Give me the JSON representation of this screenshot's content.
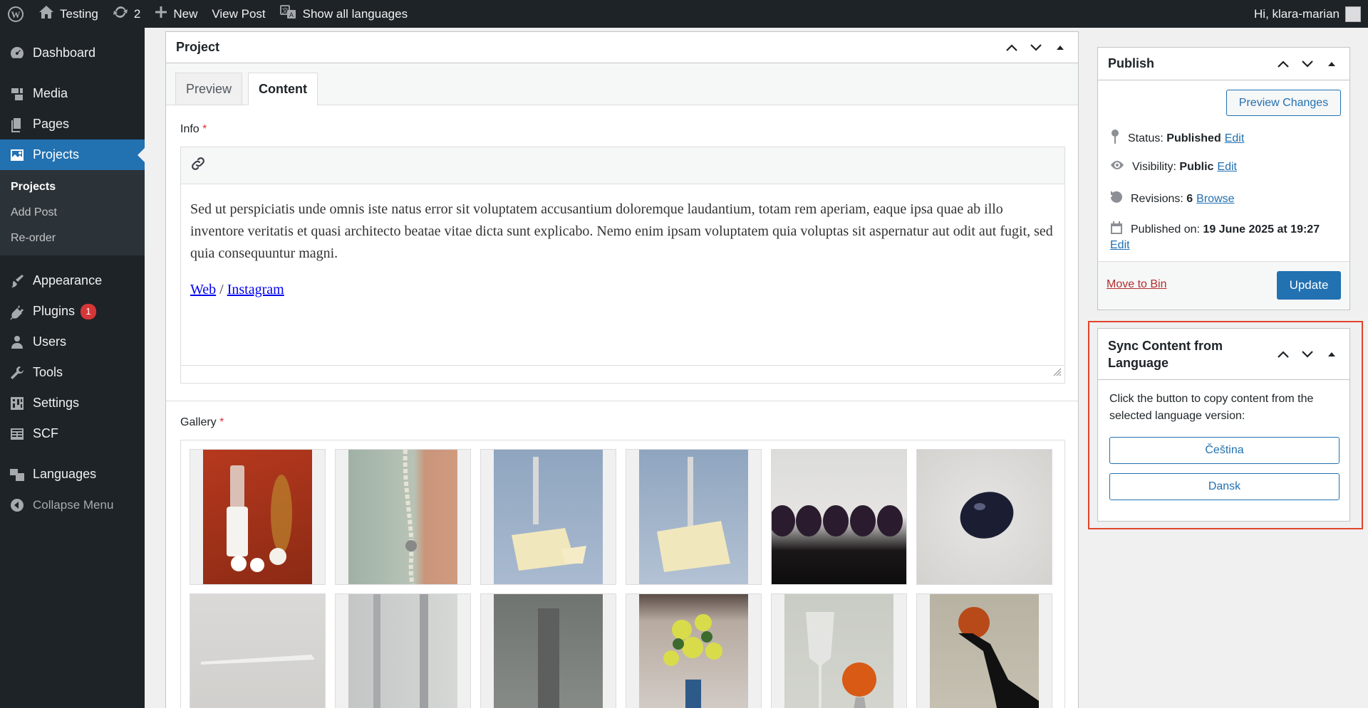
{
  "admin_bar": {
    "site_name": "Testing",
    "updates_count": "2",
    "new_label": "New",
    "view_post": "View Post",
    "show_languages": "Show all languages",
    "greeting": "Hi, klara-marian"
  },
  "sidebar": {
    "items": [
      {
        "label": "Dashboard",
        "icon": "dashboard-icon"
      },
      {
        "label": "Media",
        "icon": "media-icon"
      },
      {
        "label": "Pages",
        "icon": "pages-icon"
      },
      {
        "label": "Projects",
        "icon": "projects-icon"
      },
      {
        "label": "Appearance",
        "icon": "appearance-icon"
      },
      {
        "label": "Plugins",
        "icon": "plugins-icon",
        "badge": "1"
      },
      {
        "label": "Users",
        "icon": "users-icon"
      },
      {
        "label": "Tools",
        "icon": "tools-icon"
      },
      {
        "label": "Settings",
        "icon": "settings-icon"
      },
      {
        "label": "SCF",
        "icon": "scf-icon"
      },
      {
        "label": "Languages",
        "icon": "languages-icon"
      }
    ],
    "submenu": [
      "Projects",
      "Add Post",
      "Re-order"
    ],
    "collapse": "Collapse Menu"
  },
  "project_box": {
    "title": "Project",
    "tabs": [
      "Preview",
      "Content"
    ],
    "info_label": "Info",
    "required": "*",
    "info_text": "Sed ut perspiciatis unde omnis iste natus error sit voluptatem accusantium doloremque laudantium, totam rem aperiam, eaque ipsa quae ab illo inventore veritatis et quasi architecto beatae vitae dicta sunt explicabo. Nemo enim ipsam voluptatem quia voluptas sit aspernatur aut odit aut fugit, sed quia consequuntur magni.",
    "link_web": "Web",
    "link_sep": "/",
    "link_instagram": "Instagram",
    "gallery_label": "Gallery"
  },
  "publish": {
    "title": "Publish",
    "preview_changes": "Preview Changes",
    "status_label": "Status:",
    "status_value": "Published",
    "visibility_label": "Visibility:",
    "visibility_value": "Public",
    "revisions_label": "Revisions:",
    "revisions_value": "6",
    "browse": "Browse",
    "published_on_label": "Published on:",
    "published_on_value": "19 June 2025 at 19:27",
    "edit": "Edit",
    "move_to_bin": "Move to Bin",
    "update": "Update"
  },
  "sync": {
    "title_line1": "Sync Content from",
    "title_line2": "Language",
    "description": "Click the button to copy content from the selected language version:",
    "buttons": [
      "Čeština",
      "Dansk"
    ]
  },
  "colors": {
    "accent": "#2271b1",
    "highlight": "#e0442a",
    "admin_bg": "#1d2327"
  }
}
